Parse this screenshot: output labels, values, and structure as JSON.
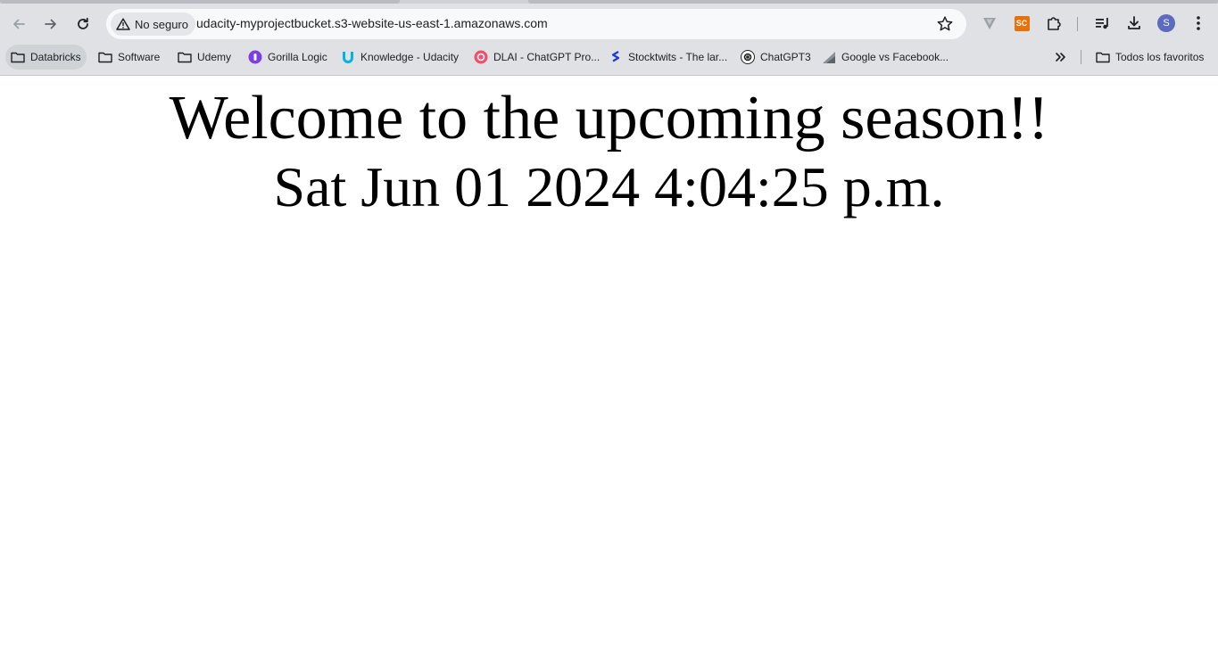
{
  "browser": {
    "security_label": "No seguro",
    "url": "udacity-myprojectbucket.s3-website-us-east-1.amazonaws.com",
    "extension_badge": "SC",
    "profile_initial": "S"
  },
  "bookmarks": {
    "items": [
      {
        "label": "Databricks",
        "icon": "folder-icon"
      },
      {
        "label": "Software",
        "icon": "folder-icon"
      },
      {
        "label": "Udemy",
        "icon": "folder-icon"
      },
      {
        "label": "Gorilla Logic",
        "icon": "gorilla-logic-icon"
      },
      {
        "label": "Knowledge - Udacity",
        "icon": "udacity-icon"
      },
      {
        "label": "DLAI - ChatGPT Pro...",
        "icon": "dlai-icon"
      },
      {
        "label": "Stocktwits - The lar...",
        "icon": "stocktwits-icon"
      },
      {
        "label": "ChatGPT3",
        "icon": "openai-icon"
      },
      {
        "label": "Google vs Facebook...",
        "icon": "chart-icon"
      }
    ],
    "all_bookmarks_label": "Todos los favoritos"
  },
  "page": {
    "headline": "Welcome to the upcoming season!!",
    "datetime": "Sat Jun 01 2024 4:04:25 p.m."
  },
  "colors": {
    "chrome_bg": "#dfe1e5",
    "omnibox_bg": "#f8f9fa",
    "extension_orange": "#e8710a",
    "avatar": "#5c6bc0",
    "udacity": "#02b3e4",
    "gorilla": "#7b3fe4",
    "dlai": "#f0506e"
  }
}
